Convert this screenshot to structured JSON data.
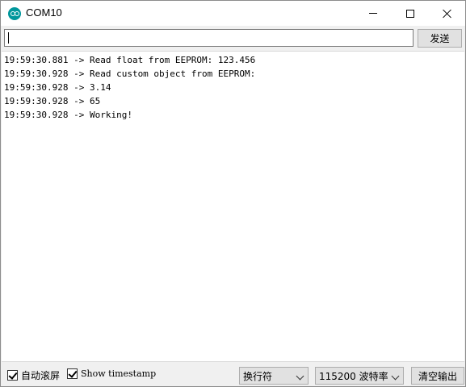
{
  "window": {
    "title": "COM10"
  },
  "input": {
    "value": "",
    "send_label": "发送"
  },
  "output": {
    "lines": [
      "19:59:30.881 -> Read float from EEPROM: 123.456",
      "19:59:30.928 -> Read custom object from EEPROM:",
      "19:59:30.928 -> 3.14",
      "19:59:30.928 -> 65",
      "19:59:30.928 -> Working!"
    ]
  },
  "status": {
    "autoscroll_label": "自动滚屏",
    "autoscroll_checked": true,
    "timestamp_label": "Show timestamp",
    "timestamp_checked": true,
    "line_ending": "换行符",
    "baud": "115200 波特率",
    "clear_label": "清空输出"
  },
  "icons": {
    "app": "arduino-icon",
    "minimize": "minimize-icon",
    "maximize": "maximize-icon",
    "close": "close-icon"
  }
}
